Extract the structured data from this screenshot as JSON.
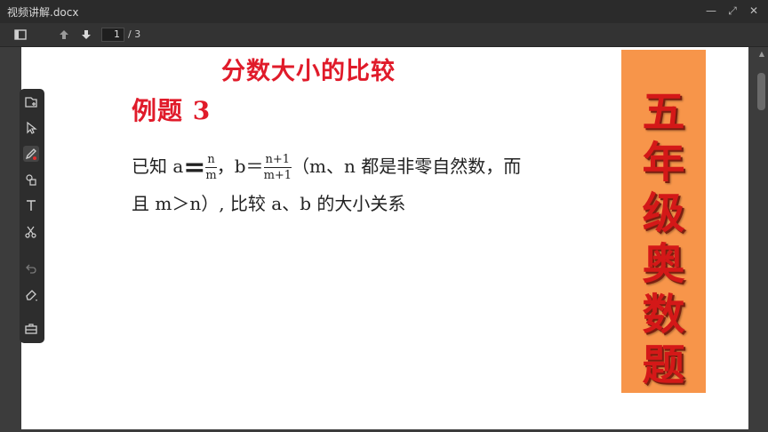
{
  "window": {
    "title": "视频讲解.docx",
    "buttons": {
      "minimize": "—",
      "restore": "⤢",
      "close": "✕"
    }
  },
  "toolbar": {
    "page_current": "1",
    "page_total": "/ 3"
  },
  "document": {
    "heading": "分数大小的比较",
    "example_label": "例题 3",
    "problem": {
      "prefix": "已知 a",
      "a_equals": "=",
      "a_num": "n",
      "a_den": "m",
      "sep_b": "，b＝",
      "b_num": "n+1",
      "b_den": "m+1",
      "rest_line1": "（m、n 都是非零自然数，而",
      "line2": "且 m＞n）, 比较 a、b 的大小关系"
    },
    "banner_text": "五年级奥数题"
  },
  "colors": {
    "heading": "#e01b2a",
    "banner_bg": "#f7954a",
    "banner_text": "#d41818"
  }
}
